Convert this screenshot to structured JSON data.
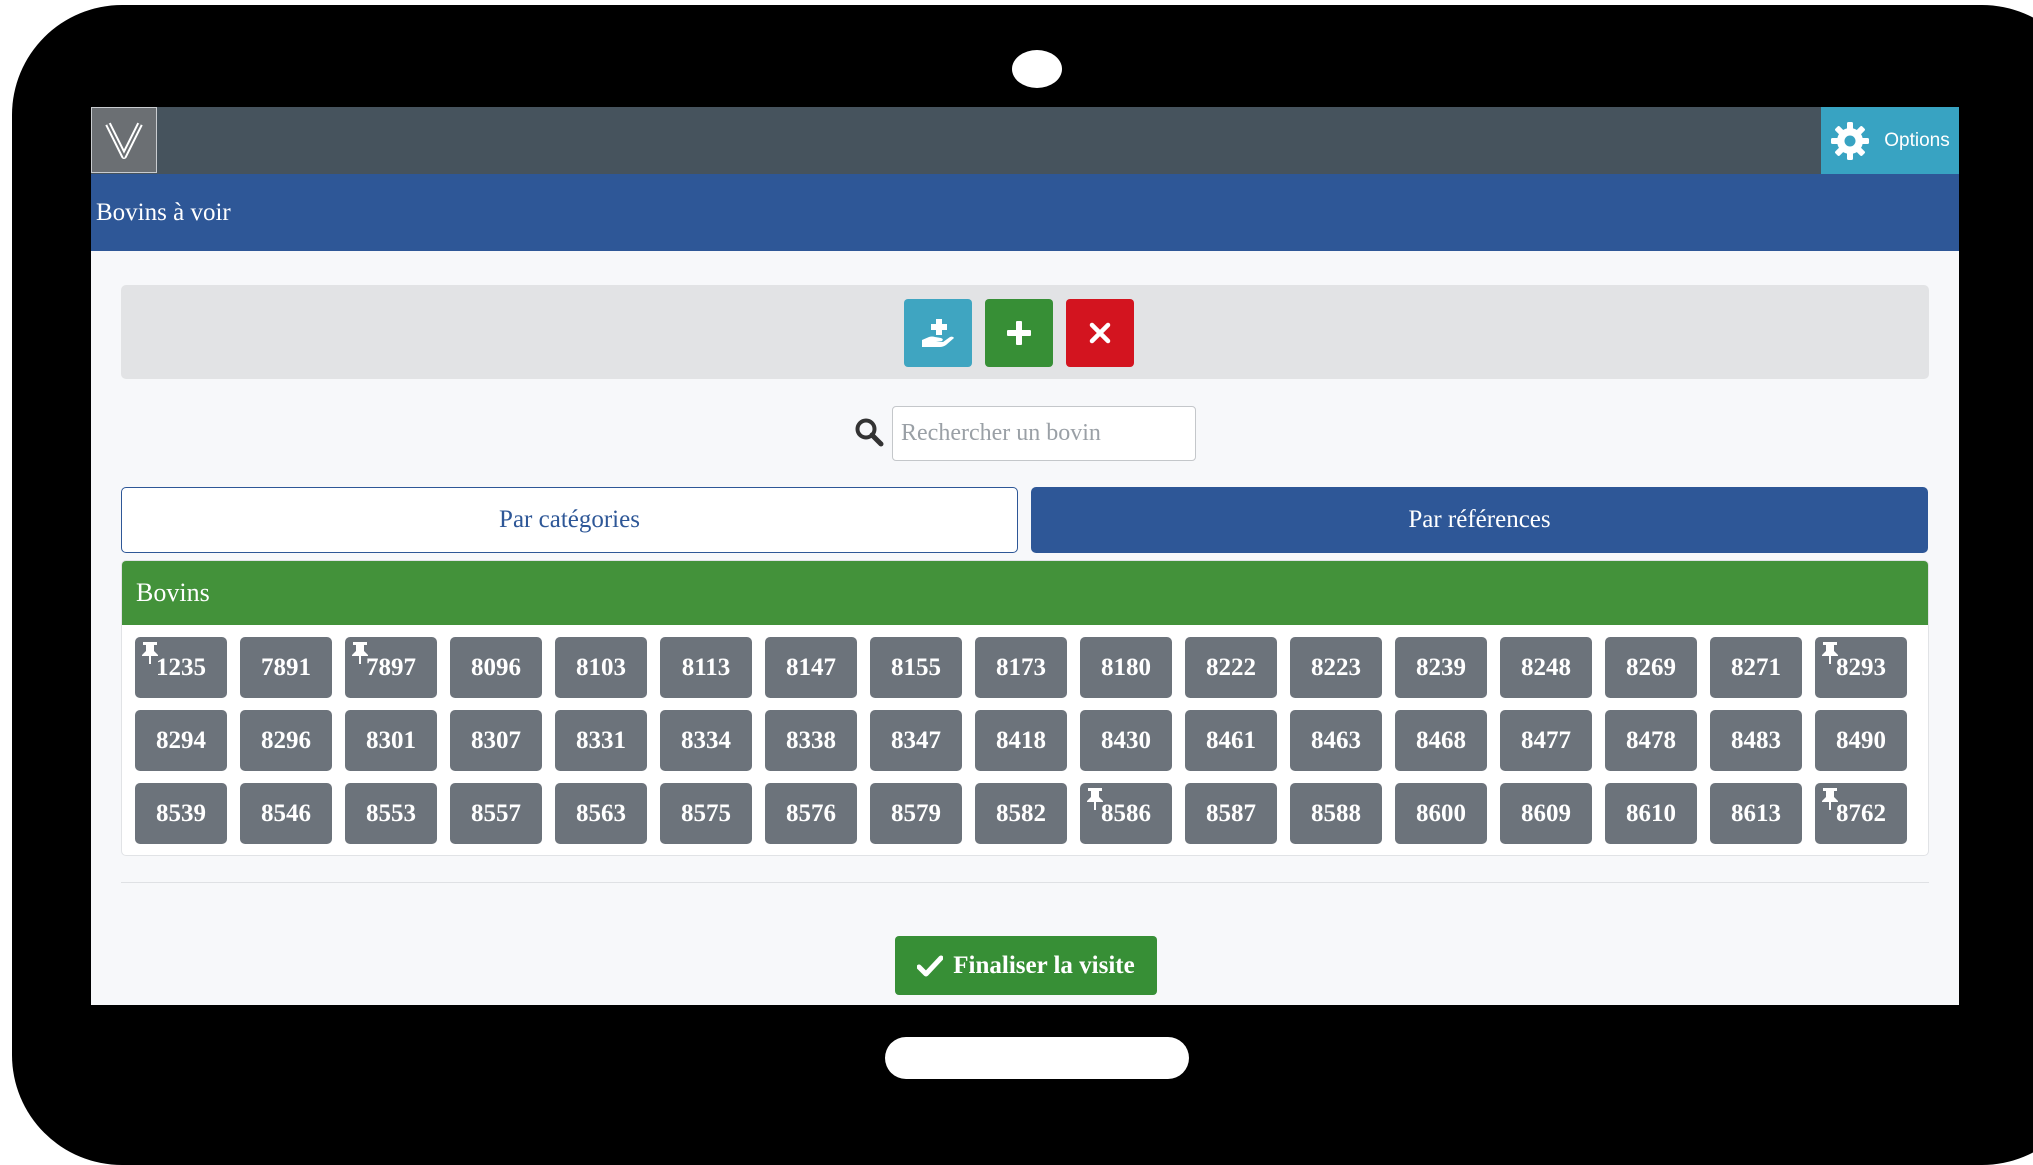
{
  "app": {
    "logo_letter": "V",
    "options_label": "Options"
  },
  "header": {
    "title": "Bovins à voir"
  },
  "actions": [
    {
      "name": "care-button",
      "icon": "hand-holding-medical-icon",
      "color": "#3fa5c1"
    },
    {
      "name": "add-button",
      "icon": "plus-icon",
      "color": "#378f36"
    },
    {
      "name": "remove-button",
      "icon": "close-icon",
      "color": "#d3141f"
    }
  ],
  "search": {
    "placeholder": "Rechercher un bovin",
    "value": ""
  },
  "tabs": [
    {
      "label": "Par catégories",
      "active": false
    },
    {
      "label": "Par références",
      "active": true
    }
  ],
  "card": {
    "title": "Bovins",
    "bovins": [
      {
        "id": "1235",
        "pinned": true
      },
      {
        "id": "7891",
        "pinned": false
      },
      {
        "id": "7897",
        "pinned": true
      },
      {
        "id": "8096",
        "pinned": false
      },
      {
        "id": "8103",
        "pinned": false
      },
      {
        "id": "8113",
        "pinned": false
      },
      {
        "id": "8147",
        "pinned": false
      },
      {
        "id": "8155",
        "pinned": false
      },
      {
        "id": "8173",
        "pinned": false
      },
      {
        "id": "8180",
        "pinned": false
      },
      {
        "id": "8222",
        "pinned": false
      },
      {
        "id": "8223",
        "pinned": false
      },
      {
        "id": "8239",
        "pinned": false
      },
      {
        "id": "8248",
        "pinned": false
      },
      {
        "id": "8269",
        "pinned": false
      },
      {
        "id": "8271",
        "pinned": false
      },
      {
        "id": "8293",
        "pinned": true
      },
      {
        "id": "8294",
        "pinned": false
      },
      {
        "id": "8296",
        "pinned": false
      },
      {
        "id": "8301",
        "pinned": false
      },
      {
        "id": "8307",
        "pinned": false
      },
      {
        "id": "8331",
        "pinned": false
      },
      {
        "id": "8334",
        "pinned": false
      },
      {
        "id": "8338",
        "pinned": false
      },
      {
        "id": "8347",
        "pinned": false
      },
      {
        "id": "8418",
        "pinned": false
      },
      {
        "id": "8430",
        "pinned": false
      },
      {
        "id": "8461",
        "pinned": false
      },
      {
        "id": "8463",
        "pinned": false
      },
      {
        "id": "8468",
        "pinned": false
      },
      {
        "id": "8477",
        "pinned": false
      },
      {
        "id": "8478",
        "pinned": false
      },
      {
        "id": "8483",
        "pinned": false
      },
      {
        "id": "8490",
        "pinned": false
      },
      {
        "id": "8539",
        "pinned": false
      },
      {
        "id": "8546",
        "pinned": false
      },
      {
        "id": "8553",
        "pinned": false
      },
      {
        "id": "8557",
        "pinned": false
      },
      {
        "id": "8563",
        "pinned": false
      },
      {
        "id": "8575",
        "pinned": false
      },
      {
        "id": "8576",
        "pinned": false
      },
      {
        "id": "8579",
        "pinned": false
      },
      {
        "id": "8582",
        "pinned": false
      },
      {
        "id": "8586",
        "pinned": true
      },
      {
        "id": "8587",
        "pinned": false
      },
      {
        "id": "8588",
        "pinned": false
      },
      {
        "id": "8600",
        "pinned": false
      },
      {
        "id": "8609",
        "pinned": false
      },
      {
        "id": "8610",
        "pinned": false
      },
      {
        "id": "8613",
        "pinned": false
      },
      {
        "id": "8762",
        "pinned": true
      }
    ]
  },
  "footer": {
    "finalize_label": "Finaliser la visite"
  },
  "colors": {
    "topbar": "#46535d",
    "primary": "#2e5797",
    "success": "#378f36",
    "danger": "#d3141f",
    "info": "#3fa5c1",
    "tag": "#6c737b"
  }
}
